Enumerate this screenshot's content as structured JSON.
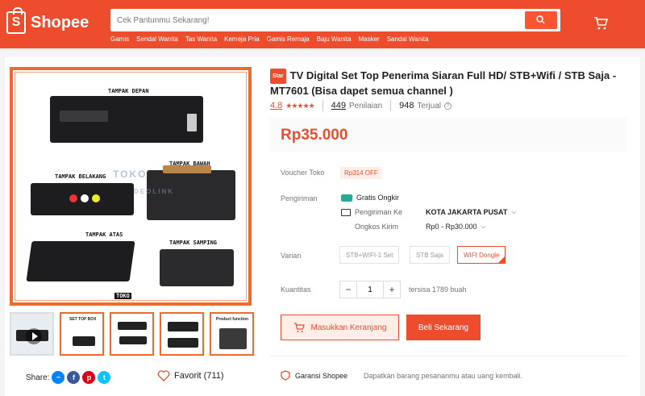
{
  "header": {
    "logo_text": "Shopee",
    "search_placeholder": "Cek Pantunmu Sekarang!",
    "categories": [
      "Gamis",
      "Sendal Wanita",
      "Tas Wanita",
      "Kemeja Pria",
      "Gamis Remaja",
      "Baju Wanita",
      "Masker",
      "Sandal Wanita"
    ]
  },
  "gallery": {
    "labels": {
      "front": "TAMPAK DEPAN",
      "back": "TAMPAK BELAKANG",
      "bottom": "TAMPAK BAWAH",
      "top": "TAMPAK ATAS",
      "side": "TAMPAK SAMPING"
    },
    "watermark": "TOKO",
    "watermark_sub": "DEOLINK",
    "brand_text": "TOKO",
    "thumb_texts": [
      "SET TOP BOX",
      "Product function"
    ]
  },
  "social": {
    "share_label": "Share:",
    "favorite_label": "Favorit (711)"
  },
  "product": {
    "badge": "Star",
    "title": "TV Digital Set Top Penerima Siaran Full HD/ STB+Wifi / STB Saja - MT7601 (Bisa dapet semua channel )",
    "rating": "4.8",
    "stars": "★★★★★",
    "reviews_count": "449",
    "reviews_label": "Penilaian",
    "sold_count": "948",
    "sold_label": "Terjual",
    "help_icon": "?",
    "price": "Rp35.000"
  },
  "voucher": {
    "label": "Voucher Toko",
    "value": "Rp314 OFF"
  },
  "shipping": {
    "label": "Pengiriman",
    "free": "Gratis Ongkir",
    "to_label": "Pengiriman Ke",
    "to_value": "KOTA JAKARTA PUSAT",
    "cost_label": "Ongkos Kirim",
    "cost_value": "Rp0 - Rp30.000"
  },
  "variants": {
    "label": "Varian",
    "options": [
      "STB+WIFI-1 Set",
      "STB Saja",
      "WIFI Dongle"
    ],
    "selected": "WIFI Dongle"
  },
  "quantity": {
    "label": "Kuantitas",
    "minus": "−",
    "value": "1",
    "plus": "+",
    "stock": "tersisa 1789 buah"
  },
  "actions": {
    "add_to_cart": "Masukkan Keranjang",
    "buy_now": "Beli Sekarang"
  },
  "guarantee": {
    "title": "Garansi Shopee",
    "text": "Dapatkan barang pesananmu atau uang kembali."
  },
  "colors": {
    "brand": "#ee4d2d",
    "free_shipping": "#26aa99"
  }
}
